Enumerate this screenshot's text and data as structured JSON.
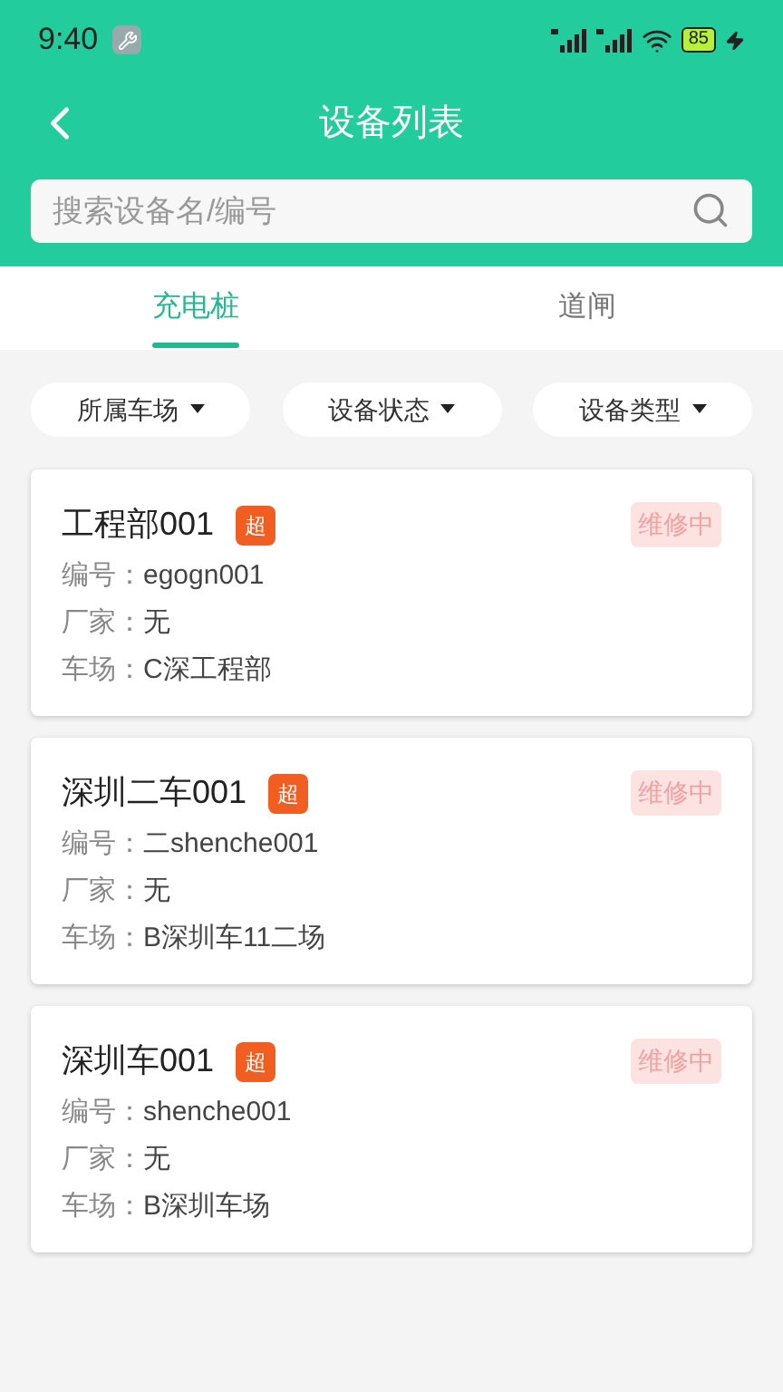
{
  "status_bar": {
    "time": "9:40",
    "battery": "85"
  },
  "header": {
    "title": "设备列表"
  },
  "search": {
    "placeholder": "搜索设备名/编号"
  },
  "tabs": [
    {
      "label": "充电桩",
      "selected": true
    },
    {
      "label": "道闸",
      "selected": false
    }
  ],
  "filters": [
    "所属车场",
    "设备状态",
    "设备类型"
  ],
  "devices": [
    {
      "name": "工程部001",
      "badge": "超",
      "status": "维修中",
      "fields": [
        {
          "label": "编号：",
          "value": "egogn001"
        },
        {
          "label": "厂家：",
          "value": "无"
        },
        {
          "label": "车场：",
          "value": "C深工程部"
        }
      ]
    },
    {
      "name": "深圳二车001",
      "badge": "超",
      "status": "维修中",
      "fields": [
        {
          "label": "编号：",
          "value": "二shenche001"
        },
        {
          "label": "厂家：",
          "value": "无"
        },
        {
          "label": "车场：",
          "value": "B深圳车11二场"
        }
      ]
    },
    {
      "name": "深圳车001",
      "badge": "超",
      "status": "维修中",
      "fields": [
        {
          "label": "编号：",
          "value": "shenche001"
        },
        {
          "label": "厂家：",
          "value": "无"
        },
        {
          "label": "车场：",
          "value": "B深圳车场"
        }
      ]
    }
  ]
}
